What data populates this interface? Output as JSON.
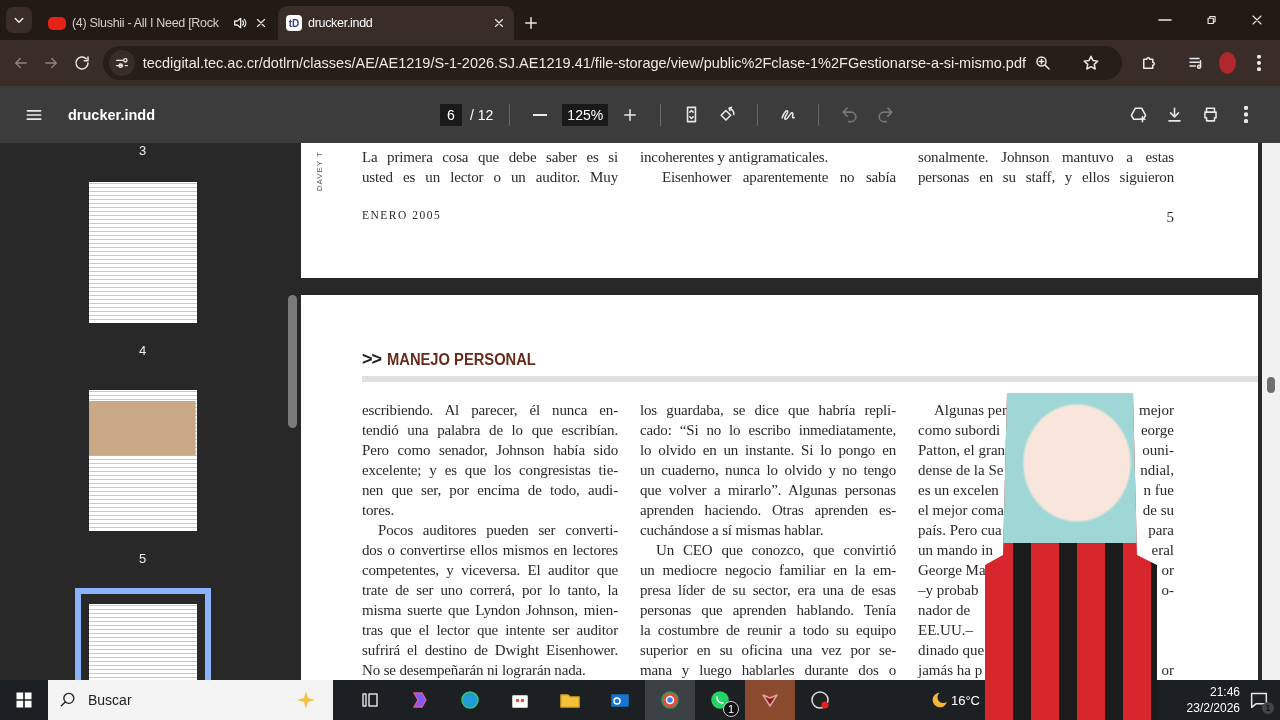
{
  "browser": {
    "tabs": [
      {
        "title": "(4) Slushii - All I Need [Rock",
        "audio": true,
        "selected": false
      },
      {
        "title": "drucker.indd",
        "favicon": "tD",
        "audio": false,
        "selected": true
      }
    ],
    "address": "tecdigital.tec.ac.cr/dotlrn/classes/AE/AE1219/S-1-2026.SJ.AE1219.41/file-storage/view/public%2Fclase-1%2FGestionarse-a-si-mismo.pdf"
  },
  "pdf_toolbar": {
    "title": "drucker.indd",
    "page": "6",
    "page_total": "/ 12",
    "zoom": "125%",
    "tools": [
      {
        "kind": "fit",
        "disabled": false
      },
      {
        "kind": "rotate",
        "disabled": false
      },
      {
        "kind": "draw",
        "disabled": false
      },
      {
        "kind": "undo",
        "disabled": true
      },
      {
        "kind": "redo",
        "disabled": true
      }
    ]
  },
  "sidebar": {
    "thumbnails": [
      {
        "label": "3",
        "kind": "cut",
        "selected": false
      },
      {
        "label": "4",
        "kind": "text",
        "selected": false
      },
      {
        "label": "5",
        "kind": "illustrated",
        "selected": false
      },
      {
        "kind": "text",
        "selected": true
      }
    ]
  },
  "page_prev": {
    "side_label": "DAVEY T",
    "footer_left": "ENERO 2005",
    "page_number": "5",
    "columns": [
      [
        {
          "indent": false,
          "complete": false,
          "lines": [
            "La primera cosa que debe saber es si",
            "usted es un lector o un auditor. Muy"
          ]
        }
      ],
      [
        {
          "indent": false,
          "complete": true,
          "lines": [
            "incoherentes y antigramaticales."
          ]
        },
        {
          "indent": true,
          "complete": false,
          "lines": [
            "Eisenhower aparentemente no sabía"
          ]
        }
      ],
      [
        {
          "indent": false,
          "complete": false,
          "lines": [
            "sonalmente. Johnson mantuvo a estas",
            "personas en su staff, y ellos siguieron"
          ]
        }
      ]
    ]
  },
  "page_current": {
    "section_mark": ">>",
    "section_title": "MANEJO PERSONAL",
    "columns": [
      [
        {
          "indent": false,
          "lines": [
            "escribiendo. Al parecer, él nunca en-",
            "tendió una palabra de lo que escribían.",
            "Pero como senador, Johnson había sido",
            "excelente; y es que los congresistas tie-",
            "nen que ser, por encima de todo, audi-",
            "tores."
          ]
        },
        {
          "indent": true,
          "complete": true,
          "lines": [
            "Pocos auditores pueden ser converti-",
            "dos o convertirse ellos mismos en lectores",
            "competentes, y viceversa. El auditor que",
            "trate de ser uno correrá, por lo tanto, la",
            "misma suerte que Lyndon Johnson, mien-",
            "tras que el lector que intente ser auditor",
            "sufrirá el destino de Dwight Eisenhower.",
            "No se desempeñarán ni lograrán nada."
          ]
        }
      ],
      [
        {
          "indent": false,
          "complete": true,
          "lines": [
            "los guardaba, se dice que habría repli-",
            "cado: “Si no lo escribo inmediatamente,",
            "lo olvido en un instante. Si lo pongo en",
            "un cuaderno, nunca lo olvido y no tengo",
            "que volver a mirarlo”. Algunas personas",
            "aprenden haciendo. Otras aprenden es-",
            "cuchándose a sí mismas hablar."
          ]
        },
        {
          "indent": true,
          "complete": false,
          "lines": [
            "Un CEO que conozco, que convirtió",
            "un mediocre negocio familiar en la em-",
            "presa líder de su sector, era una de esas",
            "personas que aprenden hablando. Tenía",
            "la costumbre de reunir a todo su equipo",
            "superior en su oficina una vez por se-",
            "mana y luego hablarles durante dos o"
          ]
        }
      ]
    ],
    "covered_column": [
      {
        "indent": true,
        "left": "Algunas per",
        "right": "mejor"
      },
      {
        "indent": false,
        "left": "como subordi",
        "right": "eorge"
      },
      {
        "indent": false,
        "left": "Patton, el gran",
        "right": "ouni-"
      },
      {
        "indent": false,
        "left": "dense de la Se",
        "right": "ndial,"
      },
      {
        "indent": false,
        "left": "es un excelen",
        "right": "n fue"
      },
      {
        "indent": false,
        "left": "el mejor coma",
        "right": "de su"
      },
      {
        "indent": false,
        "left": "país. Pero cua",
        "right": "para"
      },
      {
        "indent": false,
        "left": "un mando in",
        "right": "eral"
      },
      {
        "indent": false,
        "left": "George Ma",
        "right": "or"
      },
      {
        "indent": false,
        "left": "–y probab",
        "right": "o-"
      },
      {
        "indent": false,
        "left": "nador de"
      },
      {
        "indent": false,
        "left": "EE.UU.–"
      },
      {
        "indent": false,
        "left": "dinado que"
      },
      {
        "indent": false,
        "left": "jamás ha p",
        "right": "or"
      }
    ]
  },
  "taskbar": {
    "search_placeholder": "Buscar",
    "apps": [
      {
        "kind": "taskview",
        "selected": false
      },
      {
        "kind": "copilot",
        "selected": false
      },
      {
        "kind": "edge",
        "selected": false
      },
      {
        "kind": "store",
        "selected": false
      },
      {
        "kind": "folder",
        "selected": false
      },
      {
        "kind": "outlook",
        "selected": false
      },
      {
        "kind": "chrome",
        "selected": true
      },
      {
        "kind": "whatsapp",
        "selected": false,
        "badge": "1"
      },
      {
        "kind": "game",
        "selected": true
      },
      {
        "kind": "obs",
        "selected": false
      }
    ],
    "weather": "16°C",
    "time": "21:46",
    "date": "23/2/2026",
    "notifications": "1"
  }
}
